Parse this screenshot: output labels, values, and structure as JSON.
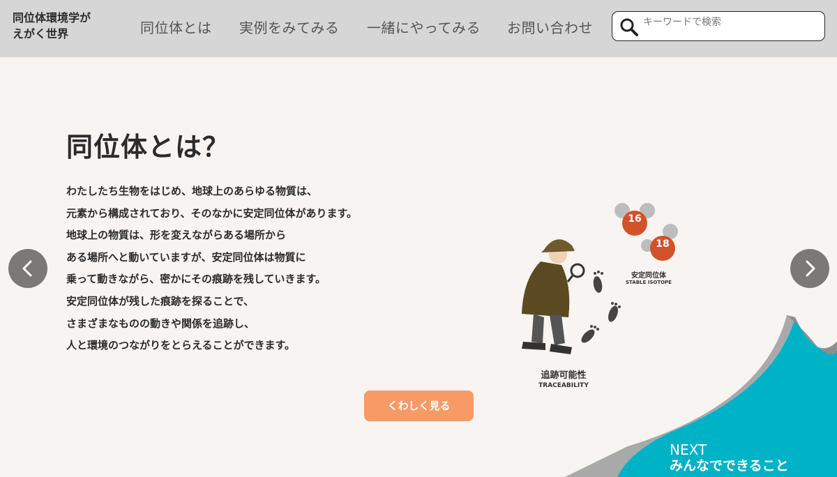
{
  "header": {
    "logo": "同位体環境学が\nえがく世界",
    "nav": [
      "同位体とは",
      "実例をみてみる",
      "一緒にやってみる",
      "お問い合わせ"
    ],
    "search_placeholder": "キーワードで検索"
  },
  "main": {
    "title": "同位体とは？",
    "body_lines": [
      "わたしたち生物をはじめ、地球上のあらゆる物質は、",
      "元素から構成されており、そのなかに安定同位体があります。",
      "地球上の物質は、形を変えながらある場所から",
      "ある場所へと動いていますが、安定同位体は物質に",
      "乗って動きながら、密かにその痕跡を残していきます。",
      "安定同位体が残した痕跡を探ることで、",
      "さまざまなものの動きや関係を追跡し、",
      "人と環境のつながりをとらえることができます。"
    ],
    "button_label": "くわしく見る"
  },
  "illustration": {
    "isotope_16": "16",
    "isotope_18": "18",
    "stable_isotope_ja": "安定同位体",
    "stable_isotope_en": "STABLE ISOTOPE",
    "traceability_ja": "追跡可能性",
    "traceability_en": "TRACEABILITY"
  },
  "next": {
    "label": "NEXT",
    "title": "みんなでできること"
  },
  "colors": {
    "header_bg": "#d6d6d6",
    "page_bg": "#f7f4f1",
    "button": "#f79a66",
    "teal": "#00b2c6",
    "isotope_red": "#d2522a"
  },
  "icons": [
    "search-icon",
    "chevron-left-icon",
    "chevron-right-icon",
    "detective-icon",
    "footprint-icon"
  ]
}
